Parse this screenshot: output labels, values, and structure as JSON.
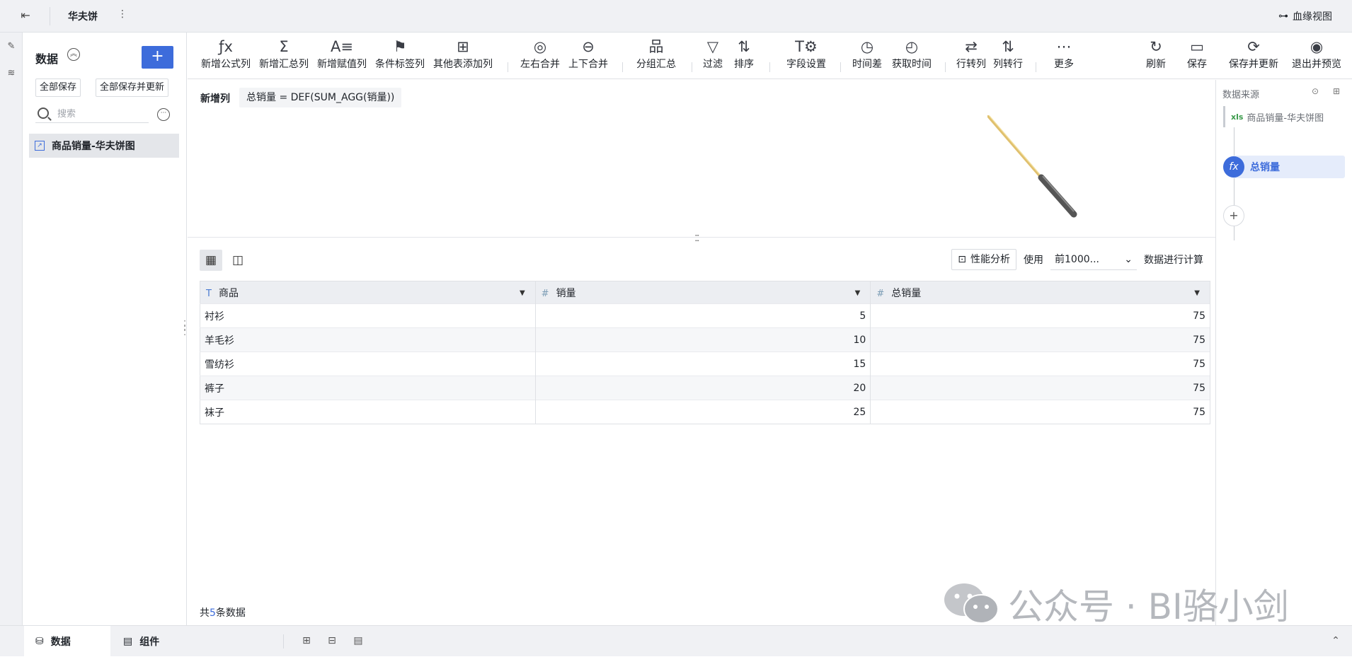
{
  "topbar": {
    "title": "华夫饼",
    "more": "⋮",
    "lineage": "血缘视图"
  },
  "left_panel": {
    "title": "数据",
    "add": "+",
    "save_all": "全部保存",
    "save_all_update": "全部保存并更新",
    "search_placeholder": "搜索",
    "items": [
      {
        "label": "商品销量-华夫饼图"
      }
    ]
  },
  "toolbar": {
    "items": [
      {
        "label": "新增公式列",
        "icon": "ƒx"
      },
      {
        "label": "新增汇总列",
        "icon": "Σ"
      },
      {
        "label": "新增赋值列",
        "icon": "A≡"
      },
      {
        "label": "条件标签列",
        "icon": "⚑"
      },
      {
        "label": "其他表添加列",
        "icon": "⊞"
      },
      {
        "label": "左右合并",
        "icon": "◎"
      },
      {
        "label": "上下合并",
        "icon": "⊖"
      },
      {
        "label": "分组汇总",
        "icon": "品"
      },
      {
        "label": "过滤",
        "icon": "▽"
      },
      {
        "label": "排序",
        "icon": "⇅"
      },
      {
        "label": "字段设置",
        "icon": "T⚙"
      },
      {
        "label": "时间差",
        "icon": "◷"
      },
      {
        "label": "获取时间",
        "icon": "◴"
      },
      {
        "label": "行转列",
        "icon": "⇄"
      },
      {
        "label": "列转行",
        "icon": "⇅"
      },
      {
        "label": "更多",
        "icon": "⋯"
      },
      {
        "label": "刷新",
        "icon": "↻"
      },
      {
        "label": "保存",
        "icon": "▭"
      },
      {
        "label": "保存并更新",
        "icon": "⟳"
      },
      {
        "label": "退出并预览",
        "icon": "◉"
      }
    ]
  },
  "formula": {
    "label": "新增列",
    "expression": "总销量 = DEF(SUM_AGG(销量))"
  },
  "table_controls": {
    "perf": "性能分析",
    "use": "使用",
    "rows_option": "前1000...",
    "calc": "数据进行计算"
  },
  "table": {
    "columns": [
      {
        "name": "商品",
        "type": "T"
      },
      {
        "name": "销量",
        "type": "#"
      },
      {
        "name": "总销量",
        "type": "#"
      }
    ],
    "rows": [
      [
        "衬衫",
        "5",
        "75"
      ],
      [
        "羊毛衫",
        "10",
        "75"
      ],
      [
        "雪纺衫",
        "15",
        "75"
      ],
      [
        "裤子",
        "20",
        "75"
      ],
      [
        "袜子",
        "25",
        "75"
      ]
    ]
  },
  "count": {
    "prefix": "共",
    "num": "5",
    "suffix": "条数据"
  },
  "right_panel": {
    "title": "数据来源",
    "source": "商品销量-华夫饼图",
    "source_icon": "xls",
    "node": "总销量",
    "node_icon": "fx",
    "add": "+"
  },
  "watermark": "公众号 · BI骆小剑",
  "bottombar": {
    "tab_data": "数据",
    "tab_component": "组件"
  },
  "colors": {
    "accent": "#3d6cdb",
    "bg": "#f0f1f4"
  }
}
